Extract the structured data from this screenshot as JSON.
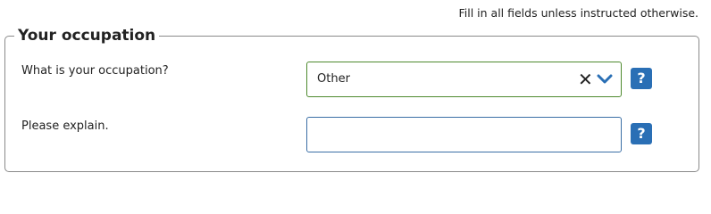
{
  "instructions": "Fill in all fields unless instructed otherwise.",
  "section": {
    "title": "Your occupation"
  },
  "occupation": {
    "label": "What is your occupation?",
    "selected_value": "Other",
    "clear_glyph": "✕",
    "help_glyph": "?"
  },
  "explain": {
    "label": "Please explain.",
    "value": "",
    "help_glyph": "?"
  },
  "colors": {
    "help_button": "#2a6fb5",
    "select_border": "#4e8a2e",
    "input_border": "#3a6ea5",
    "chevron": "#2a6fb5"
  },
  "icons": {
    "clear": "close-icon",
    "dropdown": "chevron-down-icon",
    "help": "help-icon"
  }
}
